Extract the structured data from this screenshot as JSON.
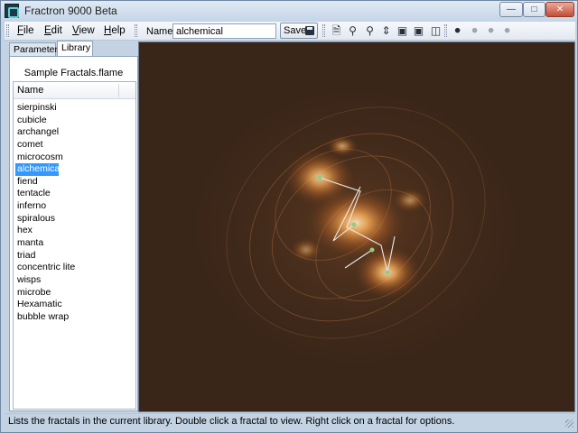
{
  "window": {
    "title": "Fractron 9000 Beta"
  },
  "menu": {
    "file": "File",
    "edit": "Edit",
    "view": "View",
    "help": "Help"
  },
  "toolbar": {
    "name_label": "Name:",
    "name_value": "alchemical",
    "save_label": "Save",
    "icons": [
      "new-document-icon",
      "zoom-in-icon",
      "zoom-out-icon",
      "vertical-resize-icon",
      "camera-icon",
      "camera-alt-icon",
      "compare-icon",
      "add-transform-icon",
      "remove-transform-icon",
      "copy-transform-icon",
      "delete-transform-icon"
    ]
  },
  "tabs": {
    "parameters": "Parameters",
    "library": "Library"
  },
  "library": {
    "title": "Sample Fractals.flame",
    "column_header": "Name",
    "items": [
      "sierpinski",
      "cubicle",
      "archangel",
      "comet",
      "microcosm",
      "alchemical",
      "fiend",
      "tentacle",
      "inferno",
      "spiralous",
      "hex",
      "manta",
      "triad",
      "concentric lite",
      "wisps",
      "microbe",
      "Hexamatic",
      "bubble wrap"
    ],
    "selected": "alchemical"
  },
  "status": {
    "text": "Lists the fractals in the current library. Double click a fractal to view. Right click on a fractal for options."
  },
  "colors": {
    "canvas_bg": "#3a2619",
    "selection": "#3399ff",
    "fractal_glow": "#ffb25a"
  }
}
